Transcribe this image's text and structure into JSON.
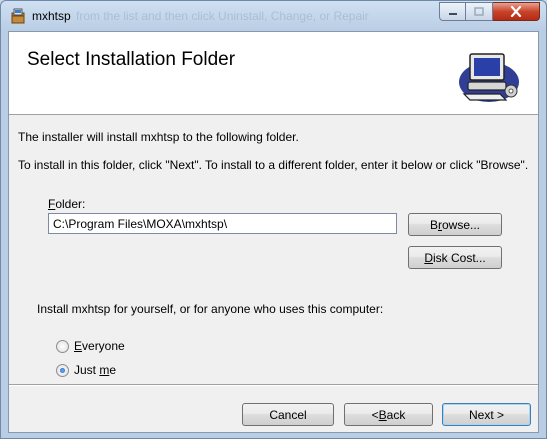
{
  "window": {
    "title": "mxhtsp",
    "ghost_title": "from the list and then click Uninstall, Change, or Repair",
    "icon": "installer-icon"
  },
  "header": {
    "title": "Select Installation Folder",
    "graphic": "computer-setup-icon"
  },
  "body": {
    "line1": "The installer will install mxhtsp to the following folder.",
    "line2": "To install in this folder, click \"Next\". To install to a different folder, enter it below or click \"Browse\".",
    "install_for": "Install mxhtsp for yourself, or for anyone who uses this computer:"
  },
  "folder": {
    "label_pre": "",
    "label_key": "F",
    "label_post": "older:",
    "value": "C:\\Program Files\\MOXA\\mxhtsp\\"
  },
  "buttons": {
    "browse_pre": "B",
    "browse_key": "r",
    "browse_post": "owse...",
    "diskcost_pre": "",
    "diskcost_key": "D",
    "diskcost_post": "isk Cost...",
    "cancel": "Cancel",
    "back_pre": "< ",
    "back_key": "B",
    "back_post": "ack",
    "next": "Next >"
  },
  "options": {
    "everyone_pre": "",
    "everyone_key": "E",
    "everyone_post": "veryone",
    "everyone_selected": false,
    "justme_pre": "Just ",
    "justme_key": "m",
    "justme_post": "e",
    "justme_selected": true
  },
  "colors": {
    "title_bar": "#b9cde4",
    "close_button": "#c8442b",
    "dialog_bg": "#f0f0f0",
    "header_bg": "#ffffff",
    "default_button_border": "#3c7fb1"
  }
}
